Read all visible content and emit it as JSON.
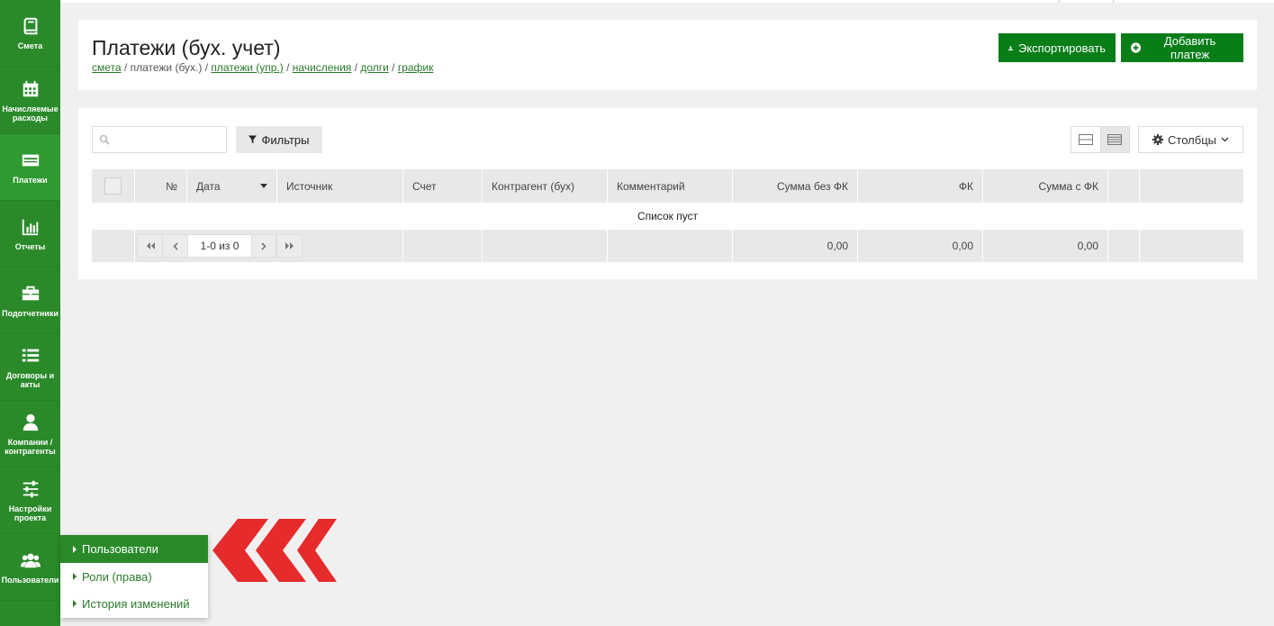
{
  "sidebar": {
    "items": [
      {
        "label": "Смета",
        "icon": "book-icon"
      },
      {
        "label": "Начисляемые расходы",
        "icon": "calendar-icon"
      },
      {
        "label": "Платежи",
        "icon": "credit-card-icon"
      },
      {
        "label": "Отчеты",
        "icon": "bar-chart-icon"
      },
      {
        "label": "Подотчетники",
        "icon": "briefcase-icon"
      },
      {
        "label": "Договоры и акты",
        "icon": "list-icon"
      },
      {
        "label": "Компании / контрагенты",
        "icon": "user-icon"
      },
      {
        "label": "Настройки проекта",
        "icon": "sliders-icon"
      },
      {
        "label": "Пользователи",
        "icon": "users-icon"
      }
    ]
  },
  "header": {
    "title": "Платежи (бух. учет)",
    "breadcrumb": {
      "smeta": "смета",
      "sep1": " / ",
      "current": "платежи (бух.)",
      "sep2": " / ",
      "upr": "платежи (упр.)",
      "sep3": " / ",
      "accruals": "начисления",
      "sep4": " / ",
      "debts": "долги",
      "sep5": " / ",
      "schedule": "график"
    },
    "export_label": "Экспортировать",
    "add_label": "Добавить платеж"
  },
  "toolbar": {
    "search_placeholder": "",
    "filters_label": "Фильтры",
    "columns_label": "Столбцы"
  },
  "table": {
    "columns": [
      "№",
      "Дата",
      "Источник",
      "Счет",
      "Контрагент (бух)",
      "Комментарий",
      "Сумма без ФК",
      "ФК",
      "Сумма с ФК"
    ],
    "empty_text": "Список пуст",
    "pager_info": "1-0 из 0",
    "totals": {
      "sum_without": "0,00",
      "fk": "0,00",
      "sum_with": "0,00"
    }
  },
  "flyout": {
    "items": [
      "Пользователи",
      "Роли (права)",
      "История изменений"
    ]
  },
  "colors": {
    "sidebar": "#2a8a2a",
    "button": "#087d18",
    "arrow": "#e52b2b"
  }
}
